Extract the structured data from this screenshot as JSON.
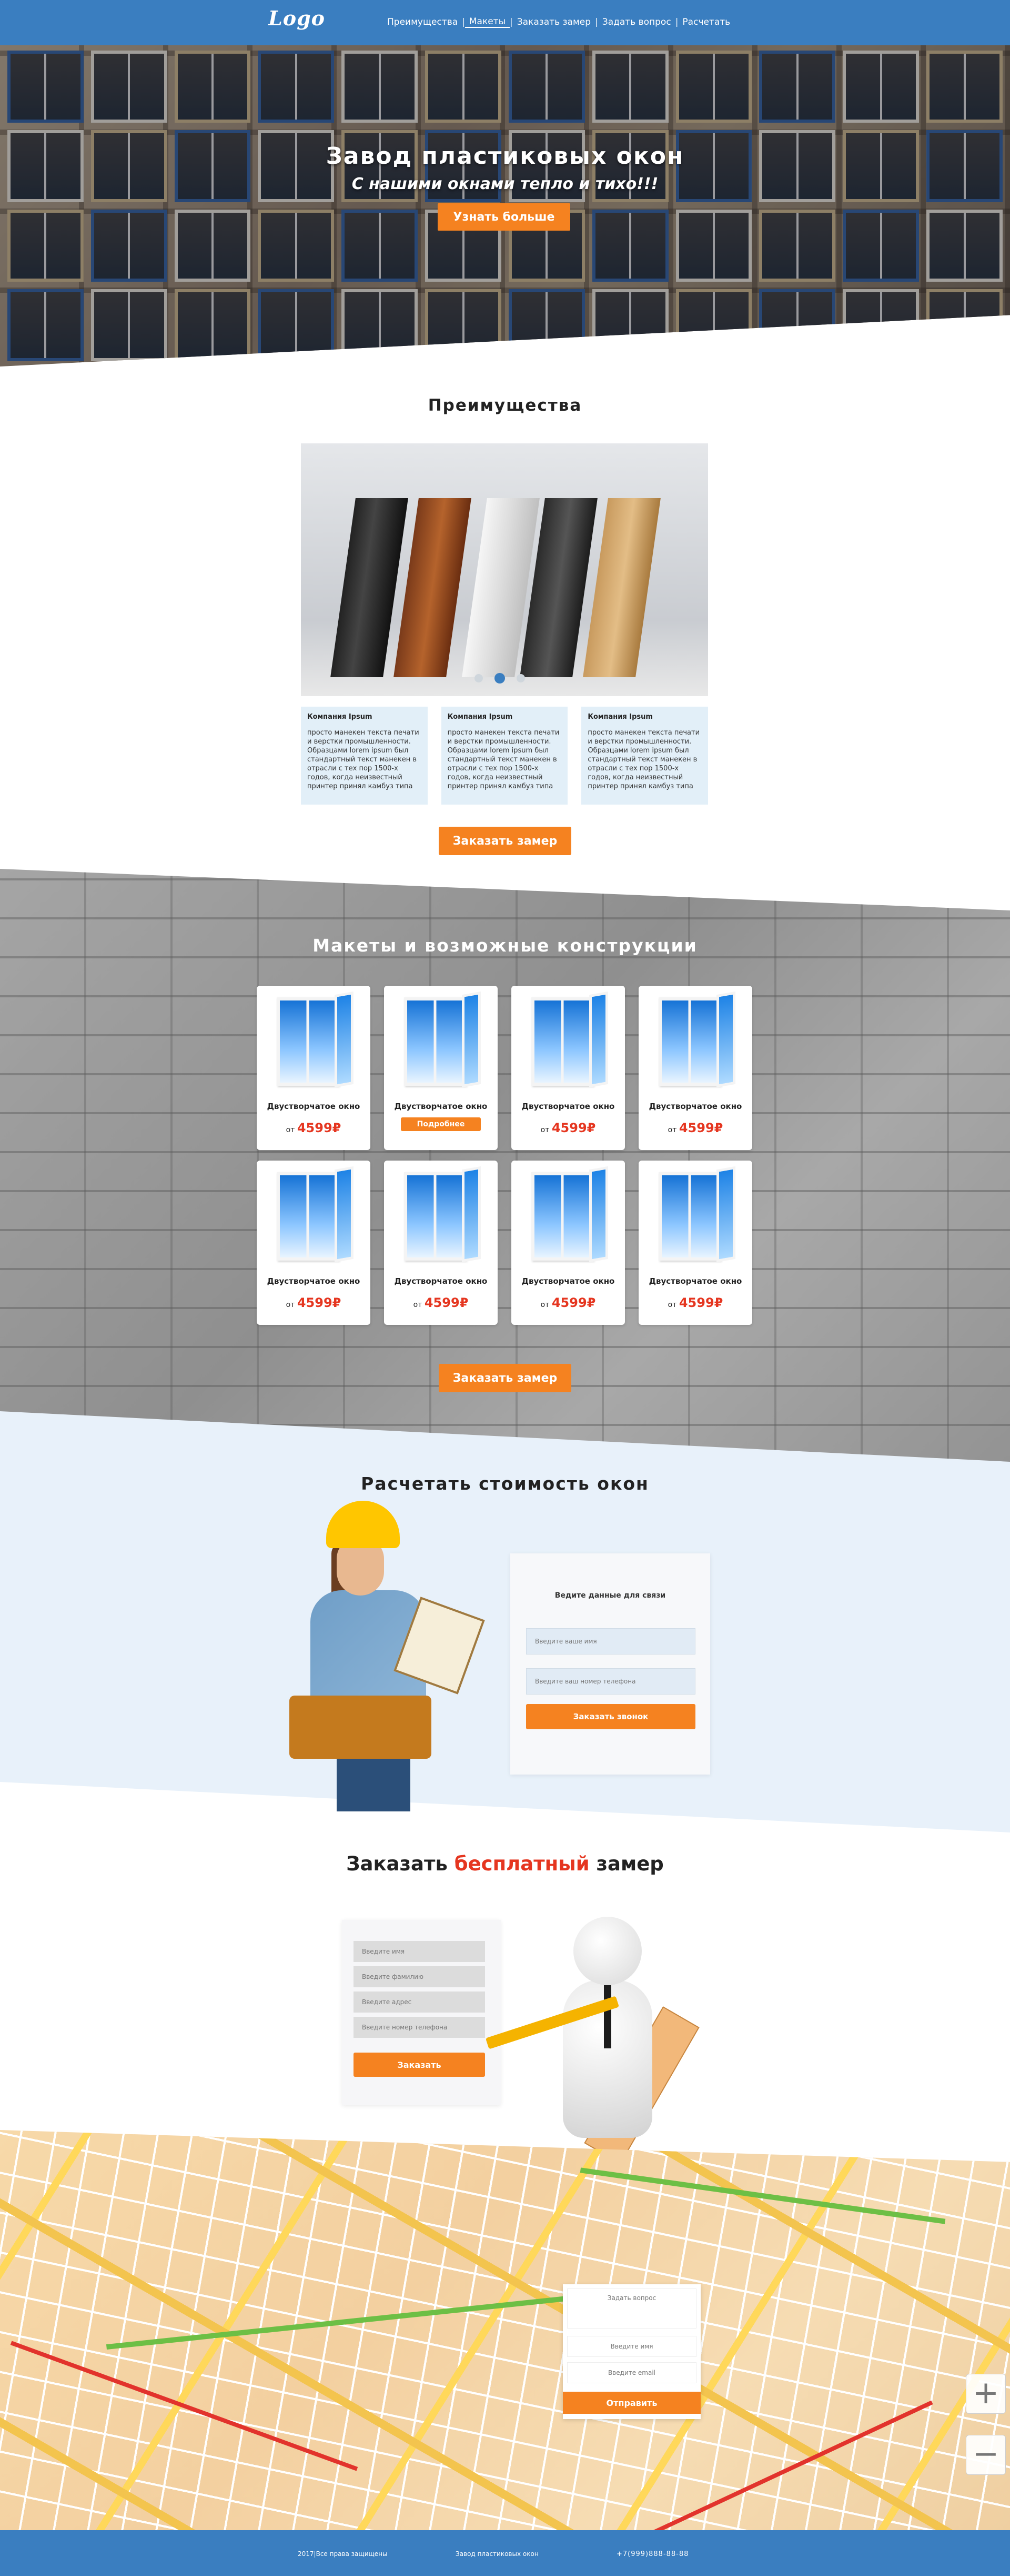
{
  "header": {
    "logo": "Logo",
    "nav": [
      {
        "label": "Преимущества",
        "active": false
      },
      {
        "label": "Макеты",
        "active": true
      },
      {
        "label": "Заказать замер",
        "active": false
      },
      {
        "label": "Задать вопрос",
        "active": false
      },
      {
        "label": "Расчетать",
        "active": false
      }
    ],
    "separator": "|"
  },
  "hero": {
    "title": "Завод пластиковых окон",
    "subtitle": "С нашими окнами тепло и тихо!!!",
    "button": "Узнать больше"
  },
  "advantages": {
    "title": "Преимущества",
    "cards": [
      {
        "title": "Компания Ipsum",
        "text": "просто манекен текста печати и верстки промышленности. Образцами lorem ipsum был стандартный текст манекен в отрасли с тех пор 1500-х годов, когда неизвестный принтер принял камбуз типа"
      },
      {
        "title": "Компания Ipsum",
        "text": "просто манекен текста печати и верстки промышленности. Образцами lorem ipsum был стандартный текст манекен в отрасли с тех пор 1500-х годов, когда неизвестный принтер принял камбуз типа"
      },
      {
        "title": "Компания Ipsum",
        "text": "просто манекен текста печати и верстки промышленности. Образцами lorem ipsum был стандартный текст манекен в отрасли с тех пор 1500-х годов, когда неизвестный принтер принял камбуз типа"
      }
    ],
    "button": "Заказать замер"
  },
  "models": {
    "title": "Макеты и возможные конструкции",
    "items": [
      {
        "name": "Двустворчатое окно",
        "price_prefix": "от",
        "price": "4599",
        "currency": "₽",
        "hover": false
      },
      {
        "name": "Двустворчатое окно",
        "price_prefix": "от",
        "price": "4599",
        "currency": "₽",
        "hover": true
      },
      {
        "name": "Двустворчатое окно",
        "price_prefix": "от",
        "price": "4599",
        "currency": "₽",
        "hover": false
      },
      {
        "name": "Двустворчатое окно",
        "price_prefix": "от",
        "price": "4599",
        "currency": "₽",
        "hover": false
      },
      {
        "name": "Двустворчатое окно",
        "price_prefix": "от",
        "price": "4599",
        "currency": "₽",
        "hover": false
      },
      {
        "name": "Двустворчатое окно",
        "price_prefix": "от",
        "price": "4599",
        "currency": "₽",
        "hover": false
      },
      {
        "name": "Двустворчатое окно",
        "price_prefix": "от",
        "price": "4599",
        "currency": "₽",
        "hover": false
      },
      {
        "name": "Двустворчатое окно",
        "price_prefix": "от",
        "price": "4599",
        "currency": "₽",
        "hover": false
      }
    ],
    "more_button": "Подробнее",
    "button": "Заказать замер"
  },
  "calc": {
    "title": "Расчетать стоимость окон",
    "form_label": "Ведите данные для связи",
    "name_placeholder": "Введите ваше имя",
    "phone_placeholder": "Введите ваш номер телефона",
    "button": "Заказать звонок"
  },
  "free": {
    "title_before": "Заказать ",
    "title_highlight": "бесплатный",
    "title_after": " замер",
    "fields": [
      "Введите имя",
      "Введите фамилию",
      "Введите адрес",
      "Введите номер телефона"
    ],
    "button": "Заказать"
  },
  "map": {
    "question_placeholder": "Задать вопрос",
    "name_placeholder": "Введите имя",
    "email_placeholder": "Введите email",
    "button": "Отправить",
    "zoom_in": "+",
    "zoom_out": "−"
  },
  "footer": {
    "copyright": "2017|Все права защищены",
    "company": "Завод пластиковых окон",
    "phone": "+7(999)888-88-88"
  },
  "colors": {
    "brand_blue": "#3a7ec0",
    "accent_orange": "#f58220",
    "price_red": "#e53620"
  }
}
